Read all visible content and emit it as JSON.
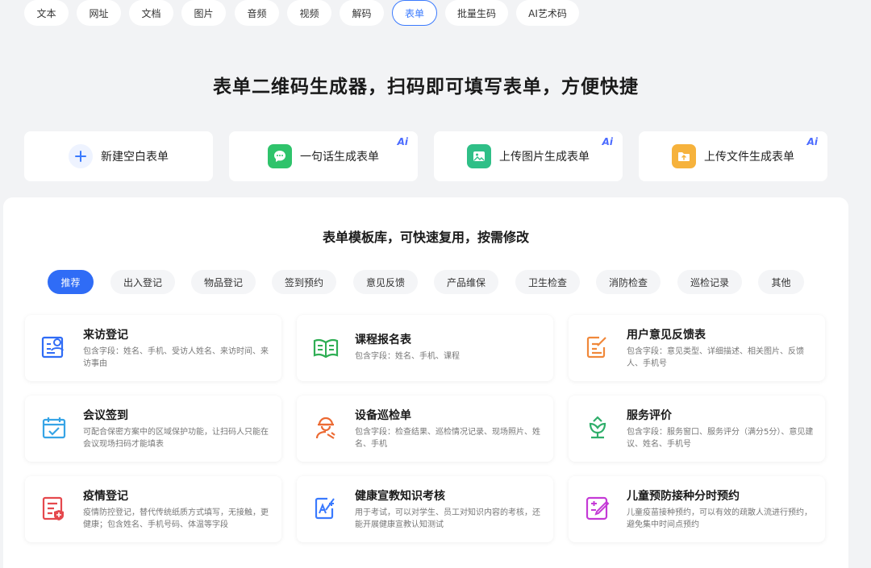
{
  "top_tabs": [
    {
      "label": "文本"
    },
    {
      "label": "网址"
    },
    {
      "label": "文档"
    },
    {
      "label": "图片"
    },
    {
      "label": "音频"
    },
    {
      "label": "视频"
    },
    {
      "label": "解码"
    },
    {
      "label": "表单"
    },
    {
      "label": "批量生码"
    },
    {
      "label": "AI艺术码"
    }
  ],
  "hero": {
    "title": "表单二维码生成器，扫码即可填写表单，方便快捷"
  },
  "actions": [
    {
      "label": "新建空白表单"
    },
    {
      "label": "一句话生成表单",
      "badge": "Ai"
    },
    {
      "label": "上传图片生成表单",
      "badge": "Ai"
    },
    {
      "label": "上传文件生成表单",
      "badge": "Ai"
    }
  ],
  "library": {
    "title": "表单模板库，可快速复用，按需修改"
  },
  "categories": [
    {
      "label": "推荐"
    },
    {
      "label": "出入登记"
    },
    {
      "label": "物品登记"
    },
    {
      "label": "签到预约"
    },
    {
      "label": "意见反馈"
    },
    {
      "label": "产品维保"
    },
    {
      "label": "卫生检查"
    },
    {
      "label": "消防检查"
    },
    {
      "label": "巡检记录"
    },
    {
      "label": "其他"
    }
  ],
  "templates": [
    {
      "title": "来访登记",
      "desc": "包含字段：姓名、手机、受访人姓名、来访时间、来访事由"
    },
    {
      "title": "课程报名表",
      "desc": "包含字段：姓名、手机、课程"
    },
    {
      "title": "用户意见反馈表",
      "desc": "包含字段：意见类型、详细描述、相关图片、反馈人、手机号"
    },
    {
      "title": "会议签到",
      "desc": "可配合保密方案中的区域保护功能，让扫码人只能在会议现场扫码才能填表"
    },
    {
      "title": "设备巡检单",
      "desc": "包含字段：检查结果、巡检情况记录、现场照片、姓名、手机"
    },
    {
      "title": "服务评价",
      "desc": "包含字段：服务窗口、服务评分（满分5分）、意见建议、姓名、手机号"
    },
    {
      "title": "疫情登记",
      "desc": "疫情防控登记，替代传统纸质方式填写，无接触，更健康；包含姓名、手机号码、体温等字段"
    },
    {
      "title": "健康宣教知识考核",
      "desc": "用于考试，可以对学生、员工对知识内容的考核，还能开展健康宣教认知测试"
    },
    {
      "title": "儿童预防接种分时预约",
      "desc": "儿童疫苗接种预约，可以有效的疏散人流进行预约，避免集中时间点预约"
    }
  ],
  "colors": {
    "accent": "#2f6cf6",
    "green": "#2fc36b",
    "yellow": "#f6b23c"
  }
}
